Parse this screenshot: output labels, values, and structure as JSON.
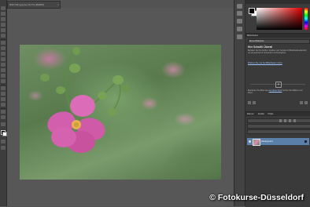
{
  "document": {
    "tab_title": "DSC7421.jpg bei 16,7% (RGB/8)",
    "close_glyph": "×"
  },
  "libraries": {
    "tabs": [
      "Bibliotheken"
    ],
    "selected_library": "Meine Bibliothek",
    "heading": "Hier Schaltfl. Überall",
    "body": "Behalten Sie Ihre Farben, Grafiken und Textstile im Bibliotheksbedienfeld, um sie jederzeit zu verwenden und freizugeben.",
    "link": "Erfahren Sie, wie Sie Bibliotheken nutzen",
    "add_glyph": "+",
    "stock_prefix": "Bearbeiten Sie Bilder aus",
    "stock_link": "der Adobe Stock",
    "stock_suffix": "Suchen Sie Millionen von Fotos"
  },
  "layers": {
    "tabs": [
      "Ebenen",
      "Kanäle",
      "Pfade"
    ],
    "layer_name": "Hintergrund"
  },
  "watermark": "© Fotokurse-Düsseldorf",
  "colors": {
    "workspace": "#535353",
    "panel": "#3c3c3c",
    "selection": "#5a7fa8"
  }
}
